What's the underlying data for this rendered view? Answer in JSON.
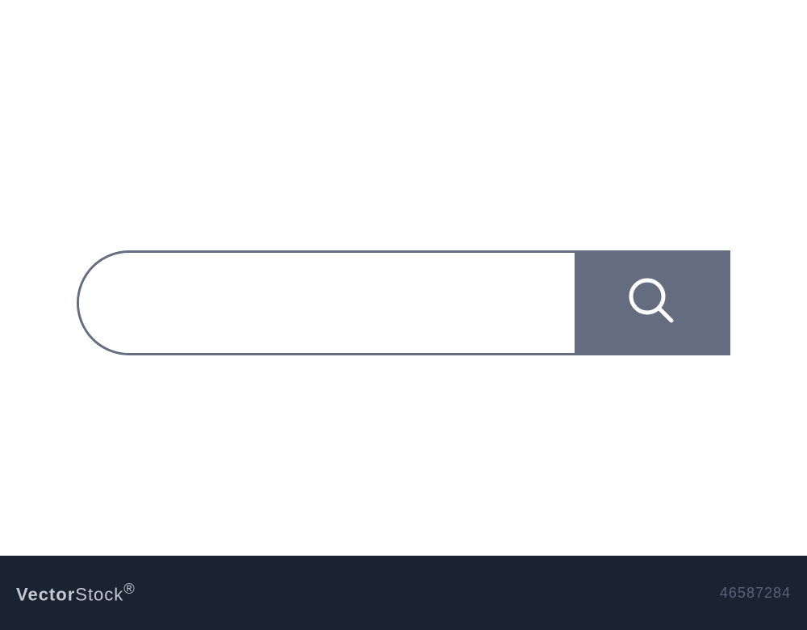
{
  "search": {
    "value": "",
    "placeholder": ""
  },
  "watermark": {
    "brand_prefix": "Vector",
    "brand_suffix": "Stock",
    "image_id": "46587284"
  },
  "colors": {
    "primary": "#646c80",
    "band": "#1a2332",
    "watermark_text": "#c5c8ce",
    "watermark_id": "#5a6275"
  }
}
